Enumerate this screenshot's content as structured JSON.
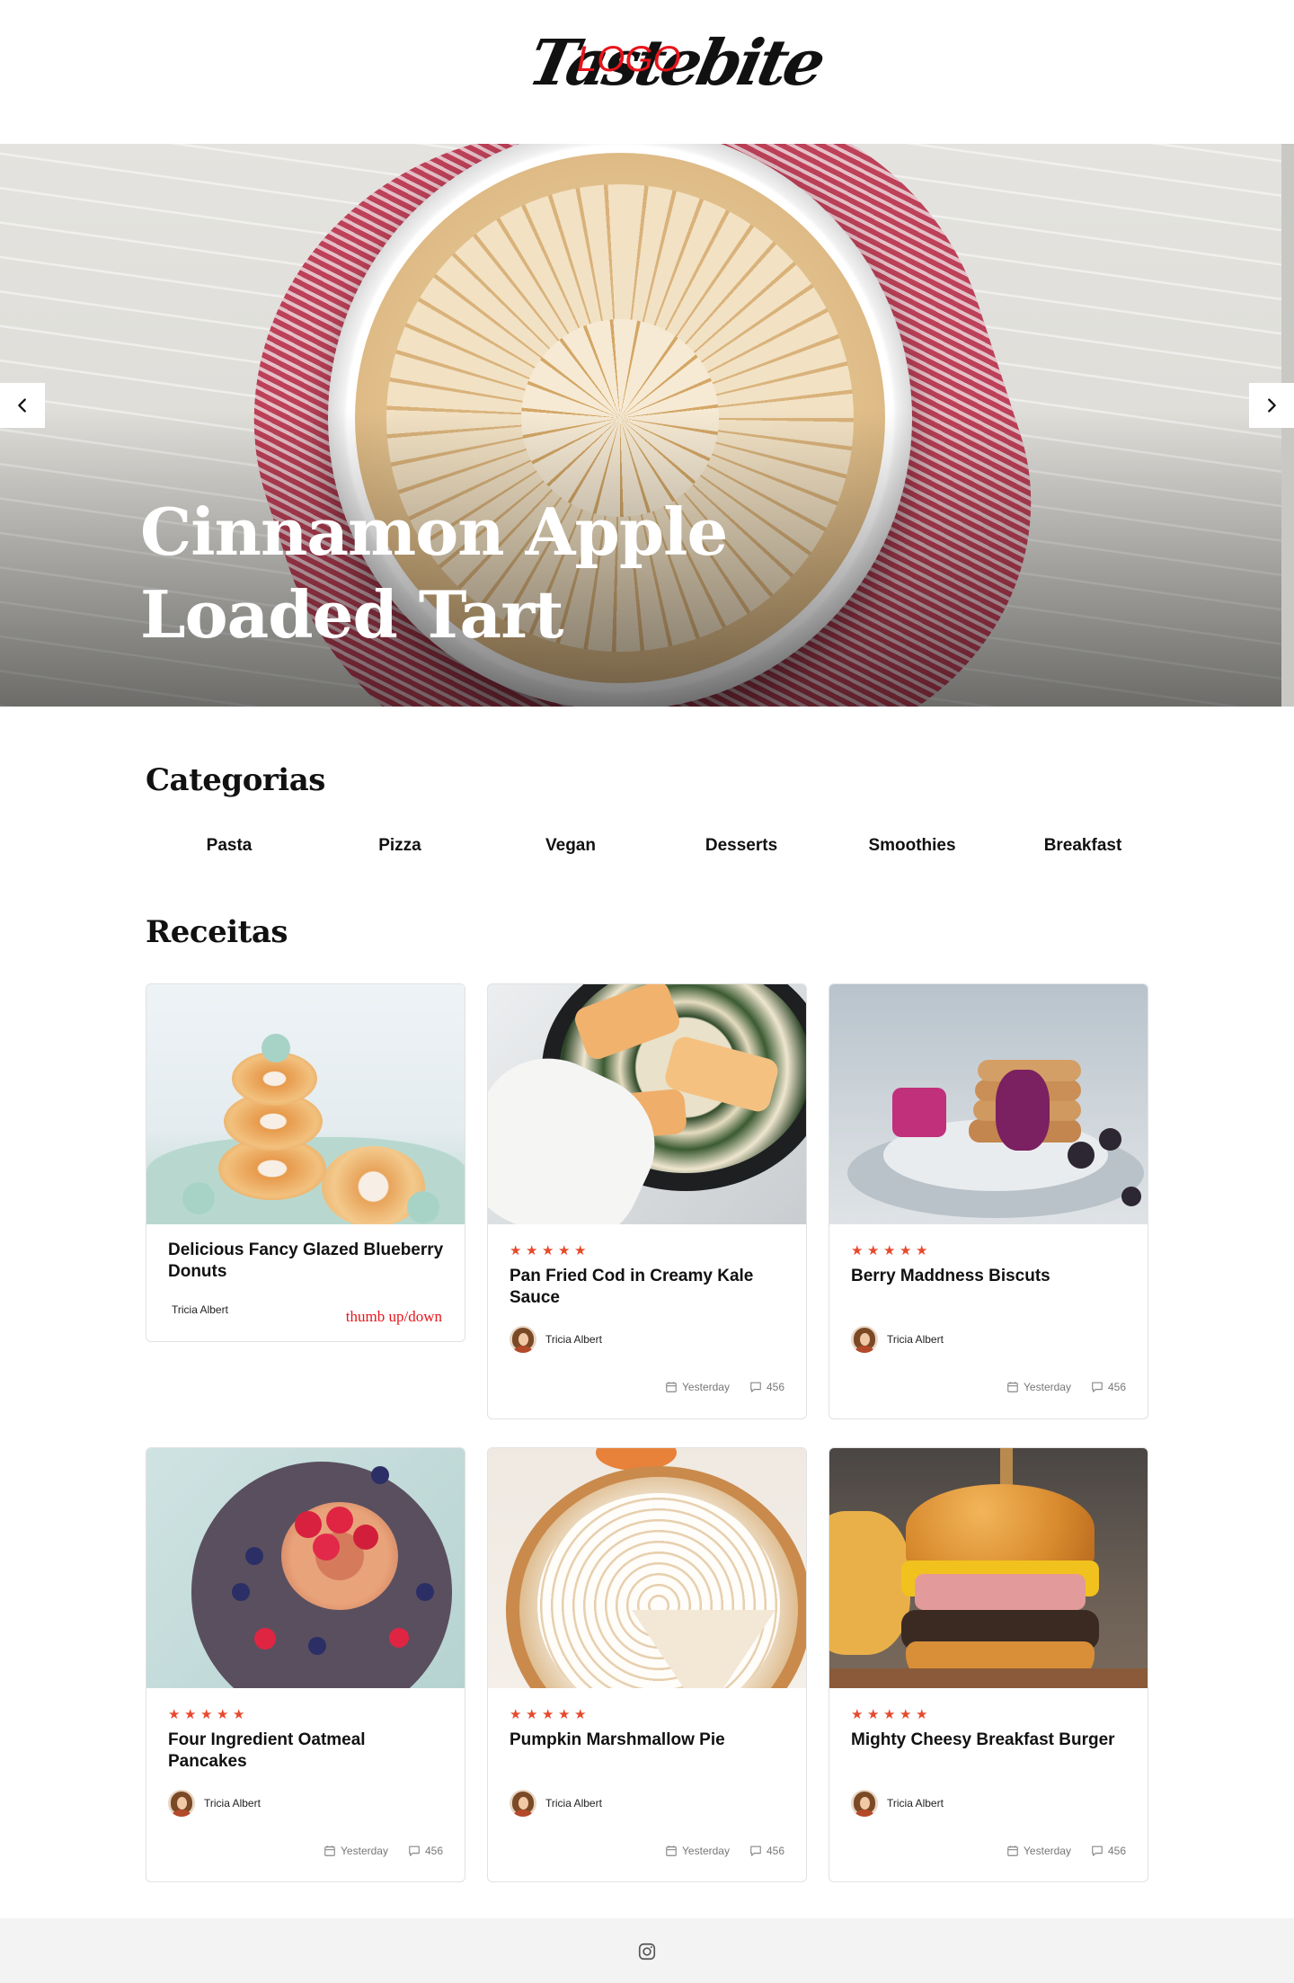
{
  "header": {
    "logo_text": "Tastebite",
    "logo_overlay": "LOGO"
  },
  "hero": {
    "title_line1": "Cinnamon Apple",
    "title_line2": "Loaded Tart",
    "prev_icon": "chevron-left-icon",
    "next_icon": "chevron-right-icon"
  },
  "categories": {
    "title": "Categorias",
    "items": [
      "Pasta",
      "Pizza",
      "Vegan",
      "Desserts",
      "Smoothies",
      "Breakfast"
    ]
  },
  "recipes": {
    "title": "Receitas",
    "cards": [
      {
        "title": "Delicious Fancy Glazed Blueberry Donuts",
        "author": "Tricia Albert",
        "note": "thumb up/down"
      },
      {
        "title": "Pan Fried Cod in Creamy Kale Sauce",
        "author": "Tricia Albert",
        "date": "Yesterday",
        "comments": "456",
        "rating": 5
      },
      {
        "title": "Berry Maddness Biscuts",
        "author": "Tricia Albert",
        "date": "Yesterday",
        "comments": "456",
        "rating": 5
      },
      {
        "title": "Four Ingredient Oatmeal Pancakes",
        "author": "Tricia Albert",
        "date": "Yesterday",
        "comments": "456",
        "rating": 5
      },
      {
        "title": "Pumpkin Marshmallow Pie",
        "author": "Tricia Albert",
        "date": "Yesterday",
        "comments": "456",
        "rating": 5
      },
      {
        "title": "Mighty Cheesy Breakfast Burger",
        "author": "Tricia Albert",
        "date": "Yesterday",
        "comments": "456",
        "rating": 5
      }
    ]
  },
  "footer": {
    "social_icon": "instagram-icon"
  },
  "colors": {
    "star": "#e8482b",
    "logo_overlay": "#e8141a"
  }
}
